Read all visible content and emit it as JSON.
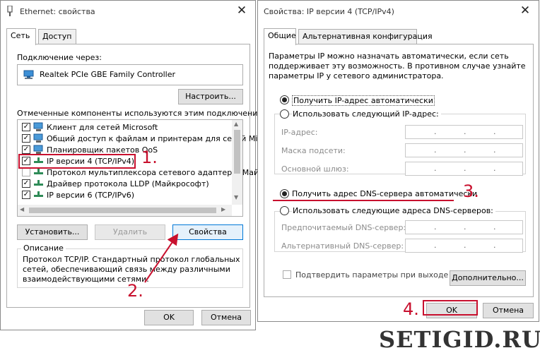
{
  "left_window": {
    "title": "Ethernet: свойства",
    "tabs": [
      "Сеть",
      "Доступ"
    ],
    "connect_via_label": "Подключение через:",
    "adapter_name": "Realtek PCIe GBE Family Controller",
    "configure_button": "Настроить...",
    "components_label": "Отмеченные компоненты используются этим подключением:",
    "components": [
      {
        "label": "Клиент для сетей Microsoft",
        "checked": true
      },
      {
        "label": "Общий доступ к файлам и принтерам для сетей Mi",
        "checked": true
      },
      {
        "label": "Планировщик пакетов QoS",
        "checked": true
      },
      {
        "label": "IP версии 4 (TCP/IPv4)",
        "checked": true
      },
      {
        "label": "Протокол мультиплексора сетевого адаптера (Май",
        "checked": false
      },
      {
        "label": "Драйвер протокола LLDP (Майкрософт)",
        "checked": true
      },
      {
        "label": "IP версии 6 (TCP/IPv6)",
        "checked": true
      }
    ],
    "install_button": "Установить...",
    "remove_button": "Удалить",
    "properties_button": "Свойства",
    "description_label": "Описание",
    "description_text": [
      "Протокол TCP/IP. Стандартный протокол глобальных",
      "сетей, обеспечивающий связь между различными",
      "взаимодействующими сетями."
    ],
    "ok_button": "OK",
    "cancel_button": "Отмена"
  },
  "right_window": {
    "title": "Свойства: IP версии 4 (TCP/IPv4)",
    "tabs": [
      "Общие",
      "Альтернативная конфигурация"
    ],
    "intro_text": [
      "Параметры IP можно назначать автоматически, если сеть",
      "поддерживает эту возможность. В противном случае узнайте",
      "параметры IP у сетевого администратора."
    ],
    "auto_ip_radio": "Получить IP-адрес автоматически",
    "manual_ip_radio": "Использовать следующий IP-адрес:",
    "ip_address_label": "IP-адрес:",
    "subnet_label": "Маска подсети:",
    "gateway_label": "Основной шлюз:",
    "auto_dns_radio": "Получить адрес DNS-сервера автоматически",
    "manual_dns_radio": "Использовать следующие адреса DNS-серверов:",
    "preferred_dns_label": "Предпочитаемый DNS-сервер:",
    "alternate_dns_label": "Альтернативный DNS-сервер:",
    "validate_checkbox": "Подтвердить параметры при выходе",
    "advanced_button": "Дополнительно...",
    "ok_button": "OK",
    "cancel_button": "Отмена"
  },
  "annotations": {
    "step1": "1.",
    "step2": "2.",
    "step3": "3.",
    "step4": "4.",
    "color": "#c8102e"
  },
  "watermark": "SETIGID.RU"
}
